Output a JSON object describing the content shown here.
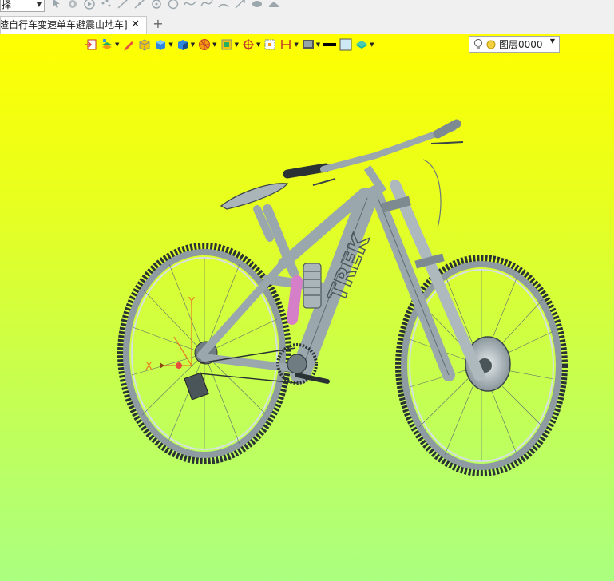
{
  "top_toolbar": {
    "filter_select_value": "择",
    "icons": [
      "pointer-icon",
      "gear-icon",
      "play-icon",
      "points-icon",
      "line-icon",
      "line2-icon",
      "circle-point-icon",
      "circle-icon",
      "spline-icon",
      "curve-icon",
      "arc-icon",
      "arrow-icon",
      "cloud-icon",
      "hat-icon"
    ]
  },
  "tabs": {
    "active_title": "渣自行车变速单车避震山地车]",
    "close_symbol": "✕",
    "new_tab_symbol": "+"
  },
  "view_toolbar": {
    "buttons": [
      "exit-icon",
      "layers-icon",
      "sketch-icon",
      "solid-icon",
      "box-icon",
      "shading-icon",
      "section-icon",
      "view-orient-icon",
      "snap-icon",
      "selection-box-icon",
      "dimension-icon",
      "display-icon",
      "line-color-icon",
      "fill-color-icon",
      "material-icon"
    ],
    "layer_label": "图层0000"
  },
  "model": {
    "brand_text": "TREK",
    "axis_labels": {
      "x": "X",
      "y": "Y"
    },
    "colors": {
      "frame": "#9aa8ad",
      "tire": "#2a3234",
      "shock": "#d47fc8",
      "background_top": "#ffff00",
      "background_bottom": "#aaff80"
    }
  }
}
